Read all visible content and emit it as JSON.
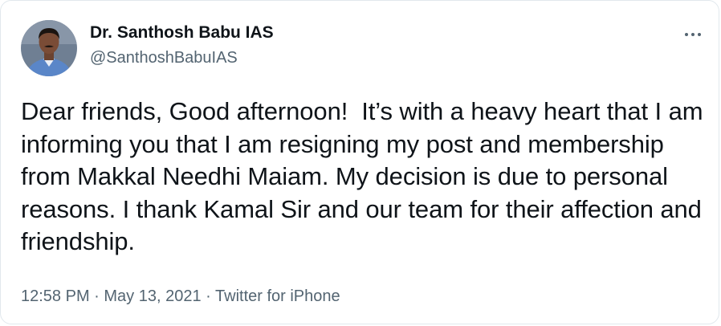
{
  "author": {
    "display_name": "Dr. Santhosh Babu IAS",
    "handle": "@SanthoshBabuIAS",
    "avatar": "profile-photo"
  },
  "more_icon": "more-horizontal-icon",
  "tweet": {
    "text": "Dear friends, Good afternoon!  It’s with a heavy heart that I am informing you that I am resigning my post and membership from Makkal Needhi Maiam. My decision is due to personal reasons. I thank Kamal Sir and our team for their affection and friendship.",
    "time": "12:58 PM",
    "date": "May 13, 2021",
    "source": "Twitter for iPhone",
    "separator": "·"
  },
  "colors": {
    "text": "#0f1419",
    "secondary": "#536471",
    "border": "#e1e8ed"
  }
}
